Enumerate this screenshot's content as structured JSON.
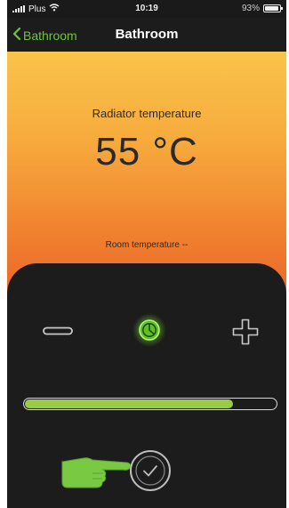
{
  "status": {
    "carrier": "Plus",
    "time": "10:19",
    "battery": "93%",
    "battery_level": 0.93
  },
  "nav": {
    "back_label": "Bathroom",
    "title": "Bathroom"
  },
  "radiator": {
    "label": "Radiator temperature",
    "value": "55 °C"
  },
  "room": {
    "label": "Room temperature --"
  },
  "controls": {
    "slider_value": 0.83
  },
  "colors": {
    "accent": "#76c043",
    "slider_fill": "#9bc94a",
    "mode_glow": "#7ad63a",
    "hero_top": "#f9c44a",
    "hero_bottom": "#ea6428",
    "panel": "#1c1c1c"
  },
  "icons": {
    "back": "chevron-left-icon",
    "wifi": "wifi-icon",
    "battery": "battery-icon",
    "minus": "minus-icon",
    "mode": "clock-mode-icon",
    "plus": "plus-icon",
    "pointer": "pointing-hand-icon",
    "confirm": "checkmark-icon"
  }
}
